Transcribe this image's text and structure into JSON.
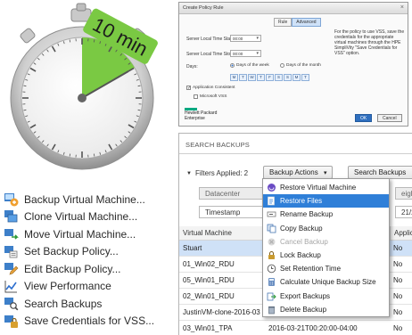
{
  "timer": {
    "label": "10 min",
    "fraction": 0.1667,
    "colors": {
      "accent": "#7ac943",
      "face": "#ffffff",
      "rim": "#b8b8b8"
    }
  },
  "actions_menu": {
    "items": [
      {
        "label": "Backup Virtual Machine...",
        "icon": "backup-vm-icon"
      },
      {
        "label": "Clone Virtual Machine...",
        "icon": "clone-vm-icon"
      },
      {
        "label": "Move Virtual Machine...",
        "icon": "move-vm-icon"
      },
      {
        "label": "Set Backup Policy...",
        "icon": "backup-policy-icon"
      },
      {
        "label": "Edit Backup Policy...",
        "icon": "edit-policy-icon"
      },
      {
        "label": "View Performance",
        "icon": "performance-chart-icon"
      },
      {
        "label": "Search Backups",
        "icon": "search-backups-icon"
      },
      {
        "label": "Save Credentials for VSS...",
        "icon": "save-credentials-icon"
      }
    ]
  },
  "policy_dialog": {
    "title": "Create Policy Rule",
    "close": "×",
    "tabs": [
      "Rule",
      "Advanced"
    ],
    "active_tab": "Advanced",
    "start_label": "Server Local Time Start:",
    "start_value": "00:00",
    "stop_label": "Server Local Time Stop:",
    "stop_value": "00:00",
    "days_label": "Days:",
    "radio_week": "Days of the week",
    "radio_month": "Days of the month",
    "day_buttons": [
      "M",
      "T",
      "W",
      "T",
      "F",
      "S",
      "S",
      "M",
      "T"
    ],
    "app_consistent": "Application Consistent",
    "microsoft_vss": "Microsoft VSS",
    "vss_note": "For the policy to use VSS, save the credentials for the appropriate virtual machines through the HPE SimpliVity \"Save Credentials for VSS\" option.",
    "brand_line1": "Hewlett Packard",
    "brand_line2": "Enterprise",
    "ok": "OK",
    "cancel": "Cancel",
    "colors": {
      "primary": "#2f6fbf",
      "brand": "#01a982"
    }
  },
  "search_panel": {
    "title": "SEARCH BACKUPS",
    "filters_applied": "Filters Applied: 2",
    "backup_actions": "Backup Actions",
    "search_button": "Search Backups",
    "filter_datacenter": "Datacenter",
    "filter_timestamp": "Timestamp",
    "filter_right_partial": "eigh",
    "filter_right_date_partial": "21/20",
    "columns": {
      "vm": "Virtual Machine",
      "app": "Applicat"
    },
    "rows": [
      {
        "vm": "Stuart",
        "ts": "",
        "app": "No"
      },
      {
        "vm": "01_Win02_RDU",
        "ts": "",
        "app": "No"
      },
      {
        "vm": "05_Win01_RDU",
        "ts": "",
        "app": "No"
      },
      {
        "vm": "02_Win01_RDU",
        "ts": "",
        "app": "No"
      },
      {
        "vm": "JustinVM-clone-2016-03",
        "ts": "",
        "app": "No"
      },
      {
        "vm": "03_Win01_TPA",
        "ts": "2016-03-21T00:20:00-04:00",
        "app": "No"
      }
    ],
    "selected_row": 0,
    "dropdown": {
      "items": [
        {
          "label": "Restore Virtual Machine",
          "icon": "restore-vm-icon",
          "state": "normal"
        },
        {
          "label": "Restore Files",
          "icon": "restore-files-icon",
          "state": "highlighted"
        },
        {
          "label": "Rename Backup",
          "icon": "rename-icon",
          "state": "normal"
        },
        {
          "label": "Copy Backup",
          "icon": "copy-icon",
          "state": "normal"
        },
        {
          "label": "Cancel Backup",
          "icon": "cancel-icon",
          "state": "disabled"
        },
        {
          "label": "Lock Backup",
          "icon": "lock-icon",
          "state": "normal"
        },
        {
          "label": "Set Retention Time",
          "icon": "clock-icon",
          "state": "normal"
        },
        {
          "label": "Calculate Unique Backup Size",
          "icon": "calculator-icon",
          "state": "normal"
        },
        {
          "label": "Export Backups",
          "icon": "export-icon",
          "state": "normal"
        },
        {
          "label": "Delete Backup",
          "icon": "delete-icon",
          "state": "normal"
        }
      ]
    },
    "colors": {
      "highlight": "#2f7fd8",
      "row_selected": "#cfe1f7"
    }
  }
}
